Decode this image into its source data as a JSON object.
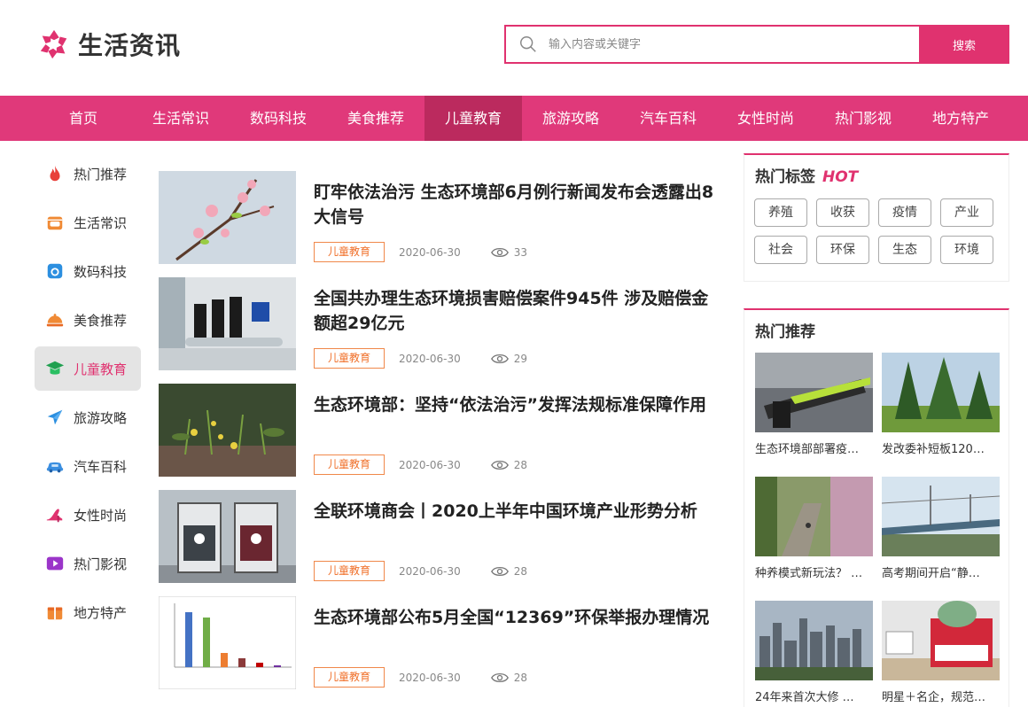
{
  "header": {
    "logo_text": "生活资讯",
    "search_placeholder": "输入内容或关键字",
    "search_button": "搜索"
  },
  "nav": {
    "items": [
      "首页",
      "生活常识",
      "数码科技",
      "美食推荐",
      "儿童教育",
      "旅游攻略",
      "汽车百科",
      "女性时尚",
      "热门影视",
      "地方特产"
    ],
    "active_index": 4
  },
  "sidebar": {
    "items": [
      {
        "label": "热门推荐",
        "icon": "flame-icon"
      },
      {
        "label": "生活常识",
        "icon": "shop-icon"
      },
      {
        "label": "数码科技",
        "icon": "camera-icon"
      },
      {
        "label": "美食推荐",
        "icon": "dish-icon"
      },
      {
        "label": "儿童教育",
        "icon": "graduation-cap-icon"
      },
      {
        "label": "旅游攻略",
        "icon": "airplane-icon"
      },
      {
        "label": "汽车百科",
        "icon": "car-icon"
      },
      {
        "label": "女性时尚",
        "icon": "high-heel-icon"
      },
      {
        "label": "热门影视",
        "icon": "play-icon"
      },
      {
        "label": "地方特产",
        "icon": "gift-box-icon"
      }
    ],
    "active_index": 4
  },
  "articles": [
    {
      "title": "盯牢依法治污 生态环境部6月例行新闻发布会透露出8大信号",
      "tag": "儿童教育",
      "date": "2020-06-30",
      "views": "33"
    },
    {
      "title": "全国共办理生态环境损害赔偿案件945件 涉及赔偿金额超29亿元",
      "tag": "儿童教育",
      "date": "2020-06-30",
      "views": "29"
    },
    {
      "title": "生态环境部：坚持“依法治污”发挥法规标准保障作用",
      "tag": "儿童教育",
      "date": "2020-06-30",
      "views": "28"
    },
    {
      "title": "全联环境商会丨2020上半年中国环境产业形势分析",
      "tag": "儿童教育",
      "date": "2020-06-30",
      "views": "28"
    },
    {
      "title": "生态环境部公布5月全国“12369”环保举报办理情况",
      "tag": "儿童教育",
      "date": "2020-06-30",
      "views": "28"
    }
  ],
  "hot_tags": {
    "title": "热门标签",
    "badge": "HOT",
    "tags": [
      "养殖",
      "收获",
      "疫情",
      "产业",
      "社会",
      "环保",
      "生态",
      "环境"
    ]
  },
  "hot_recommend": {
    "title": "热门推荐",
    "items": [
      {
        "title": "生态环境部部署疫…"
      },
      {
        "title": "发改委补短板120…"
      },
      {
        "title": "种养模式新玩法？ …"
      },
      {
        "title": "高考期间开启“静…"
      },
      {
        "title": "24年来首次大修 …"
      },
      {
        "title": "明星＋名企，规范…"
      }
    ]
  },
  "colors": {
    "brand": "#e0326f",
    "nav_bg": "#e0397a",
    "nav_active": "#bb2a5e",
    "tag_orange": "#f0702a"
  }
}
